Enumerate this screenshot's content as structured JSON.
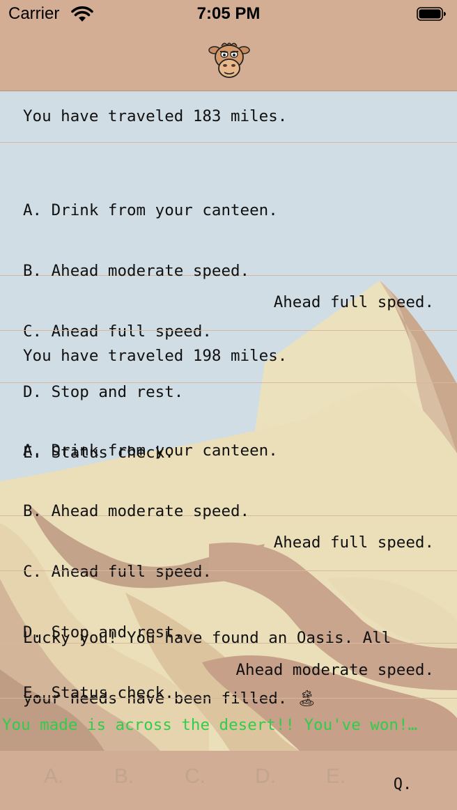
{
  "status_bar": {
    "carrier": "Carrier",
    "time": "7:05 PM",
    "wifi_icon": "wifi-icon",
    "battery_icon": "battery-icon"
  },
  "header": {
    "logo_icon": "camel-face-icon"
  },
  "colors": {
    "header_bg": "#d3ae95",
    "sky": "#d1dde4",
    "sand_light": "#ece1bd",
    "sand_dark": "#c8a58c",
    "win_text": "#33cc4a",
    "disabled_button": "#c1a48e"
  },
  "messages": [
    {
      "text": "You have traveled 183 miles."
    },
    {
      "lines": [
        "A. Drink from your canteen.",
        "B. Ahead moderate speed.",
        "C. Ahead full speed.",
        "D. Stop and rest.",
        "E. Status check."
      ]
    },
    {
      "text": "Ahead full speed."
    },
    {
      "text": "You have traveled 198 miles."
    },
    {
      "lines": [
        "A. Drink from your canteen.",
        "B. Ahead moderate speed.",
        "C. Ahead full speed.",
        "D. Stop and rest.",
        "E. Status check."
      ]
    },
    {
      "text": "Ahead full speed."
    },
    {
      "lines": [
        "Lucky you! You have found an Oasis. All",
        "your needs have been filled. 🏝"
      ]
    },
    {
      "text": "Ahead moderate speed."
    },
    {
      "text": "You made is across the desert!! You've won!…"
    }
  ],
  "buttons": [
    {
      "label": "A.",
      "enabled": false
    },
    {
      "label": "B.",
      "enabled": false
    },
    {
      "label": "C.",
      "enabled": false
    },
    {
      "label": "D.",
      "enabled": false
    },
    {
      "label": "E.",
      "enabled": false
    },
    {
      "label": "Q.",
      "enabled": true
    }
  ]
}
